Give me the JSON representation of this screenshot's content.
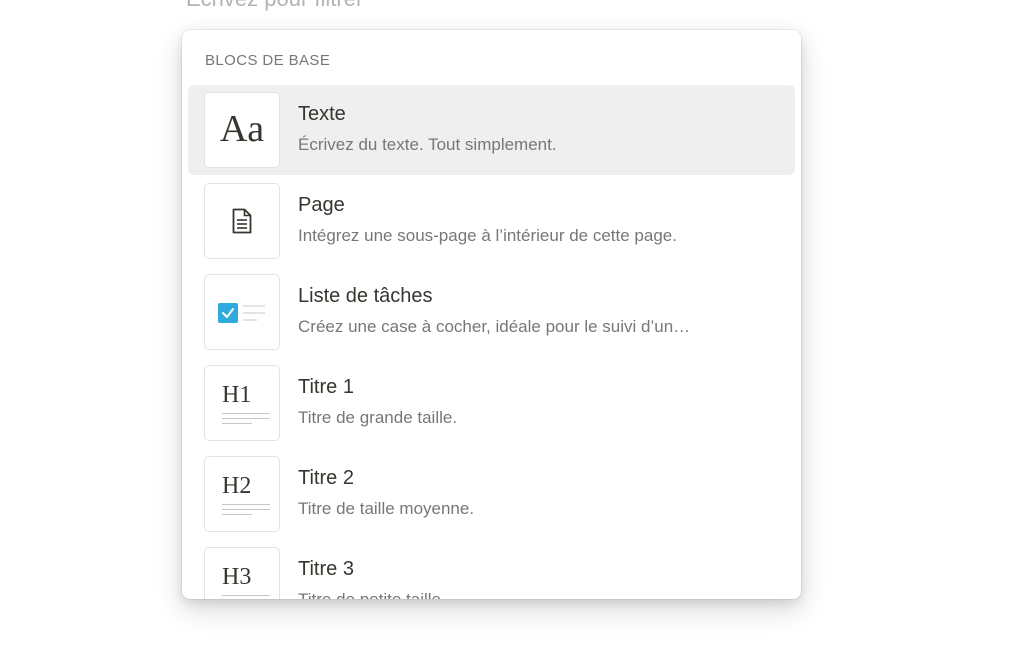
{
  "filter": {
    "placeholder": "Écrivez pour filtrer"
  },
  "menu": {
    "section_title": "BLOCS DE BASE",
    "items": [
      {
        "title": "Texte",
        "description": "Écrivez du texte. Tout simplement.",
        "icon": "text-aa-icon",
        "glyph": "Aa",
        "active": true
      },
      {
        "title": "Page",
        "description": "Intégrez une sous-page à l’intérieur de cette page.",
        "icon": "page-document-icon"
      },
      {
        "title": "Liste de tâches",
        "description": "Créez une case à cocher, idéale pour le suivi d’un…",
        "icon": "todo-checkbox-icon"
      },
      {
        "title": "Titre 1",
        "description": "Titre de grande taille.",
        "icon": "heading-1-icon",
        "glyph": "H1"
      },
      {
        "title": "Titre 2",
        "description": "Titre de taille moyenne.",
        "icon": "heading-2-icon",
        "glyph": "H2"
      },
      {
        "title": "Titre 3",
        "description": "Titre de petite taille.",
        "icon": "heading-3-icon",
        "glyph": "H3"
      }
    ]
  },
  "colors": {
    "active_row_bg": "#efefef",
    "text_primary": "#37352f",
    "text_secondary": "#787774",
    "checkbox_blue": "#2eaadc"
  }
}
